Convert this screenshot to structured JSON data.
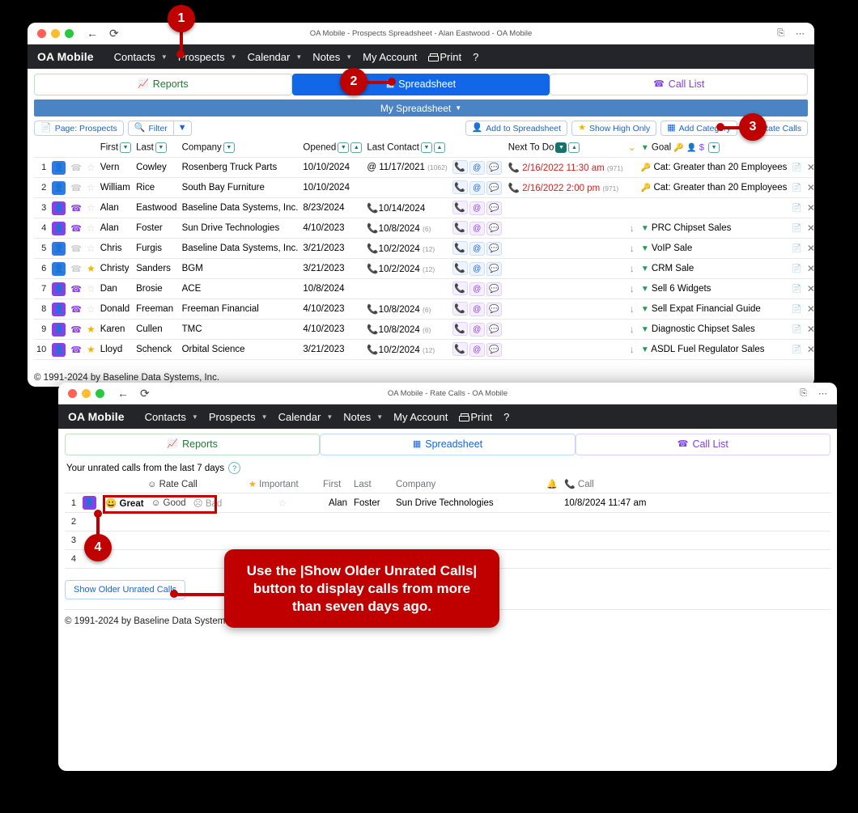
{
  "window1": {
    "title": "OA Mobile - Prospects Spreadsheet - Alan Eastwood - OA Mobile",
    "nav": {
      "brand": "OA Mobile",
      "items": [
        "Contacts",
        "Prospects",
        "Calendar",
        "Notes",
        "My Account"
      ],
      "print": "Print",
      "help": "?"
    },
    "tabs": [
      {
        "label": "Reports",
        "icon": "bar-chart-icon"
      },
      {
        "label": "Spreadsheet",
        "icon": "grid-icon"
      },
      {
        "label": "Call List",
        "icon": "telephone-icon"
      }
    ],
    "bluebar": "My Spreadsheet",
    "toolbar_left": [
      {
        "label": "Page: Prospects",
        "icon": "page-icon"
      },
      {
        "label": "Filter",
        "icon": "search-icon"
      }
    ],
    "toolbar_right": [
      {
        "label": "Add to Spreadsheet",
        "icon": "add-person-icon"
      },
      {
        "label": "Show High Only",
        "icon": "star-icon"
      },
      {
        "label": "Add Category",
        "icon": "grid-icon"
      },
      {
        "label": "Rate Calls",
        "icon": "bell-icon"
      }
    ],
    "columns": [
      "First",
      "Last",
      "Company",
      "Opened",
      "Last Contact",
      "Next To Do",
      "Goal"
    ],
    "rows": [
      {
        "n": "1",
        "avatar": "blue",
        "phone": "grey",
        "star": "grey",
        "first": "Vern",
        "last": "Cowley",
        "company": "Rosenberg Truck Parts",
        "opened": "10/10/2024",
        "contact": "11/17/2021",
        "contact_prefix": "@",
        "contact_count": "(1062)",
        "actions": "blue",
        "todo": "2/16/2022 11:30 am",
        "todo_count": "(971)",
        "goal": "Cat: Greater than 20 Employees",
        "goal_icon": "key",
        "arrow": false
      },
      {
        "n": "2",
        "avatar": "blue",
        "phone": "grey",
        "star": "grey",
        "first": "William",
        "last": "Rice",
        "company": "South Bay Furniture",
        "opened": "10/10/2024",
        "contact": "",
        "contact_prefix": "",
        "contact_count": "",
        "actions": "blue",
        "todo": "2/16/2022 2:00 pm",
        "todo_count": "(971)",
        "goal": "Cat: Greater than 20 Employees",
        "goal_icon": "key",
        "arrow": false
      },
      {
        "n": "3",
        "avatar": "purple",
        "phone": "purple",
        "star": "grey",
        "first": "Alan",
        "last": "Eastwood",
        "company": "Baseline Data Systems, Inc.",
        "opened": "8/23/2024",
        "contact": "10/14/2024",
        "contact_prefix": "phone",
        "contact_count": "",
        "actions": "purple",
        "todo": "",
        "todo_count": "",
        "goal": "",
        "goal_icon": "",
        "arrow": false
      },
      {
        "n": "4",
        "avatar": "purple",
        "phone": "purple",
        "star": "grey",
        "first": "Alan",
        "last": "Foster",
        "company": "Sun Drive Technologies",
        "opened": "4/10/2023",
        "contact": "10/8/2024",
        "contact_prefix": "phone",
        "contact_count": "(6)",
        "actions": "purple",
        "todo": "",
        "todo_count": "",
        "goal": "PRC Chipset Sales",
        "goal_icon": "flag",
        "arrow": true
      },
      {
        "n": "5",
        "avatar": "blue",
        "phone": "grey",
        "star": "grey",
        "first": "Chris",
        "last": "Furgis",
        "company": "Baseline Data Systems, Inc.",
        "opened": "3/21/2023",
        "contact": "10/2/2024",
        "contact_prefix": "phone",
        "contact_count": "(12)",
        "actions": "blue",
        "todo": "",
        "todo_count": "",
        "goal": "VoIP Sale",
        "goal_icon": "flag",
        "arrow": true
      },
      {
        "n": "6",
        "avatar": "blue",
        "phone": "grey",
        "star": "gold",
        "first": "Christy",
        "last": "Sanders",
        "company": "BGM",
        "opened": "3/21/2023",
        "contact": "10/2/2024",
        "contact_prefix": "phone",
        "contact_count": "(12)",
        "actions": "blue",
        "todo": "",
        "todo_count": "",
        "goal": "CRM Sale",
        "goal_icon": "flag",
        "arrow": true
      },
      {
        "n": "7",
        "avatar": "purple",
        "phone": "purple",
        "star": "grey",
        "first": "Dan",
        "last": "Brosie",
        "company": "ACE",
        "opened": "10/8/2024",
        "contact": "",
        "contact_prefix": "",
        "contact_count": "",
        "actions": "purple",
        "todo": "",
        "todo_count": "",
        "goal": "Sell 6 Widgets",
        "goal_icon": "flag",
        "arrow": true
      },
      {
        "n": "8",
        "avatar": "purple",
        "phone": "purple",
        "star": "grey",
        "first": "Donald",
        "last": "Freeman",
        "company": "Freeman Financial",
        "opened": "4/10/2023",
        "contact": "10/8/2024",
        "contact_prefix": "phone",
        "contact_count": "(6)",
        "actions": "purple",
        "todo": "",
        "todo_count": "",
        "goal": "Sell Expat Financial Guide",
        "goal_icon": "flag",
        "arrow": true
      },
      {
        "n": "9",
        "avatar": "purple",
        "phone": "purple",
        "star": "gold",
        "first": "Karen",
        "last": "Cullen",
        "company": "TMC",
        "opened": "4/10/2023",
        "contact": "10/8/2024",
        "contact_prefix": "phone",
        "contact_count": "(6)",
        "actions": "purple",
        "todo": "",
        "todo_count": "",
        "goal": "Diagnostic Chipset Sales",
        "goal_icon": "flag",
        "arrow": true
      },
      {
        "n": "10",
        "avatar": "purple",
        "phone": "purple",
        "star": "gold",
        "first": "Lloyd",
        "last": "Schenck",
        "company": "Orbital Science",
        "opened": "3/21/2023",
        "contact": "10/2/2024",
        "contact_prefix": "phone",
        "contact_count": "(12)",
        "actions": "purple",
        "todo": "",
        "todo_count": "",
        "goal": "ASDL Fuel Regulator Sales",
        "goal_icon": "flag",
        "arrow": true
      }
    ],
    "footer": "© 1991-2024 by Baseline Data Systems, Inc."
  },
  "window2": {
    "title": "OA Mobile - Rate Calls - OA Mobile",
    "nav": {
      "brand": "OA Mobile",
      "items": [
        "Contacts",
        "Prospects",
        "Calendar",
        "Notes",
        "My Account"
      ],
      "print": "Print",
      "help": "?"
    },
    "tabs": [
      {
        "label": "Reports",
        "icon": "bar-chart-icon"
      },
      {
        "label": "Spreadsheet",
        "icon": "grid-icon"
      },
      {
        "label": "Call List",
        "icon": "telephone-icon"
      }
    ],
    "subheading": "Your unrated calls from the last 7 days",
    "help_badge": "?",
    "columns": [
      "Rate Call",
      "Important",
      "First",
      "Last",
      "Company",
      "Call"
    ],
    "rate_options": [
      "Great",
      "Good",
      "Bad"
    ],
    "rows": [
      {
        "n": "1",
        "first": "Alan",
        "last": "Foster",
        "company": "Sun Drive Technologies",
        "call": "10/8/2024 11:47 am",
        "rated": false
      },
      {
        "n": "2",
        "first": "",
        "last": "",
        "company": "",
        "call": "",
        "rated": false
      },
      {
        "n": "3",
        "first": "",
        "last": "",
        "company": "",
        "call": "",
        "rated": false
      },
      {
        "n": "4",
        "first": "",
        "last": "",
        "company": "",
        "call": "",
        "rated": false
      }
    ],
    "show_older_label": "Show Older Unrated Calls",
    "footer": "© 1991-2024 by Baseline Data Systems, Inc."
  },
  "annotations": {
    "badges": [
      "1",
      "2",
      "3",
      "4"
    ],
    "callout": "Use the |Show Older Unrated Calls| button to display calls from more than seven days ago.",
    "accent_color": "#c00000"
  }
}
